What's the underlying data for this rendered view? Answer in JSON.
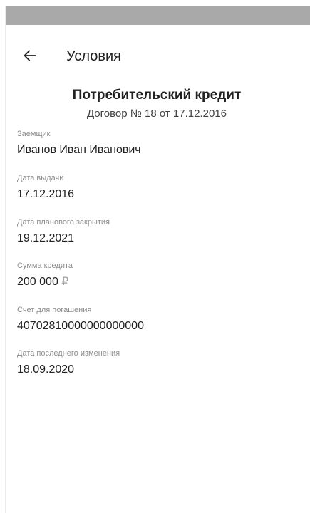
{
  "header": {
    "title": "Условия"
  },
  "loan": {
    "title": "Потребительский кредит",
    "contract": "Договор № 18 от 17.12.2016"
  },
  "fields": [
    {
      "label": "Заемщик",
      "value": "Иванов Иван Иванович"
    },
    {
      "label": "Дата выдачи",
      "value": "17.12.2016"
    },
    {
      "label": "Дата планового закрытия",
      "value": "19.12.2021"
    },
    {
      "label": "Сумма кредита",
      "value": "200 000",
      "currency": "₽"
    },
    {
      "label": "Счет для погашения",
      "value": "40702810000000000000"
    },
    {
      "label": "Дата последнего изменения",
      "value": "18.09.2020"
    }
  ],
  "colors": {
    "status_bar": "#a9a9a9",
    "text": "#212121",
    "label": "#8c8c8c"
  },
  "icons": {
    "back": "arrow-left"
  }
}
